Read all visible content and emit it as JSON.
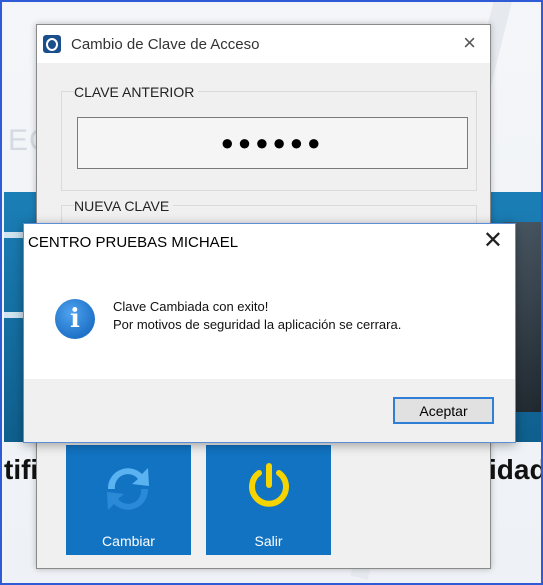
{
  "password_window": {
    "title": "Cambio de Clave de Acceso",
    "close_glyph": "×",
    "old_password_label": "CLAVE ANTERIOR",
    "old_password_value": "●●●●●●",
    "new_password_label": "NUEVA CLAVE",
    "tiles": [
      {
        "label": "Cambiar",
        "icon": "refresh-icon"
      },
      {
        "label": "Salir",
        "icon": "power-icon"
      }
    ]
  },
  "background": {
    "left_text": "tific",
    "right_text": "idad",
    "faint_text": "EC"
  },
  "message_box": {
    "title": "CENTRO PRUEBAS MICHAEL",
    "close_glyph": "✕",
    "icon": "info-icon",
    "icon_glyph": "i",
    "line1": "Clave Cambiada con exito!",
    "line2": "Por motivos de seguridad la aplicación se cerrara.",
    "ok_button": "Aceptar"
  },
  "colors": {
    "tile_blue": "#1273c2",
    "accent": "#2f7fd6",
    "power_yellow": "#f5d400"
  }
}
